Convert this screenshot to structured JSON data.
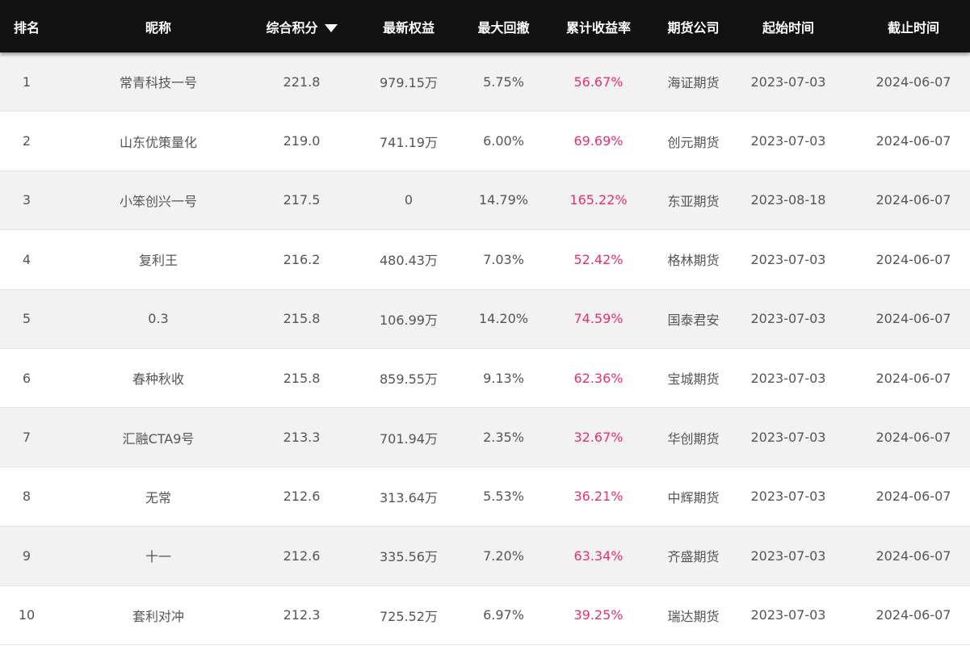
{
  "header": {
    "rank": "排名",
    "nickname": "昵称",
    "score": "综合积分",
    "equity": "最新权益",
    "drawdown": "最大回撤",
    "cumulative_return": "累计收益率",
    "broker": "期货公司",
    "start": "起始时间",
    "end": "截止时间"
  },
  "colors": {
    "header_bg": "#121212",
    "return_text": "#e8306b",
    "alt_row_bg": "#f2f2f2"
  },
  "rows": [
    {
      "rank": "1",
      "nickname": "常青科技一号",
      "score": "221.8",
      "equity": "979.15万",
      "drawdown": "5.75%",
      "cumulative_return": "56.67%",
      "broker": "海证期货",
      "start": "2023-07-03",
      "end": "2024-06-07"
    },
    {
      "rank": "2",
      "nickname": "山东优策量化",
      "score": "219.0",
      "equity": "741.19万",
      "drawdown": "6.00%",
      "cumulative_return": "69.69%",
      "broker": "创元期货",
      "start": "2023-07-03",
      "end": "2024-06-07"
    },
    {
      "rank": "3",
      "nickname": "小笨创兴一号",
      "score": "217.5",
      "equity": "0",
      "drawdown": "14.79%",
      "cumulative_return": "165.22%",
      "broker": "东亚期货",
      "start": "2023-08-18",
      "end": "2024-06-07"
    },
    {
      "rank": "4",
      "nickname": "复利王",
      "score": "216.2",
      "equity": "480.43万",
      "drawdown": "7.03%",
      "cumulative_return": "52.42%",
      "broker": "格林期货",
      "start": "2023-07-03",
      "end": "2024-06-07"
    },
    {
      "rank": "5",
      "nickname": "0.3",
      "score": "215.8",
      "equity": "106.99万",
      "drawdown": "14.20%",
      "cumulative_return": "74.59%",
      "broker": "国泰君安",
      "start": "2023-07-03",
      "end": "2024-06-07"
    },
    {
      "rank": "6",
      "nickname": "春种秋收",
      "score": "215.8",
      "equity": "859.55万",
      "drawdown": "9.13%",
      "cumulative_return": "62.36%",
      "broker": "宝城期货",
      "start": "2023-07-03",
      "end": "2024-06-07"
    },
    {
      "rank": "7",
      "nickname": "汇融CTA9号",
      "score": "213.3",
      "equity": "701.94万",
      "drawdown": "2.35%",
      "cumulative_return": "32.67%",
      "broker": "华创期货",
      "start": "2023-07-03",
      "end": "2024-06-07"
    },
    {
      "rank": "8",
      "nickname": "无常",
      "score": "212.6",
      "equity": "313.64万",
      "drawdown": "5.53%",
      "cumulative_return": "36.21%",
      "broker": "中辉期货",
      "start": "2023-07-03",
      "end": "2024-06-07"
    },
    {
      "rank": "9",
      "nickname": "十一",
      "score": "212.6",
      "equity": "335.56万",
      "drawdown": "7.20%",
      "cumulative_return": "63.34%",
      "broker": "齐盛期货",
      "start": "2023-07-03",
      "end": "2024-06-07"
    },
    {
      "rank": "10",
      "nickname": "套利对冲",
      "score": "212.3",
      "equity": "725.52万",
      "drawdown": "6.97%",
      "cumulative_return": "39.25%",
      "broker": "瑞达期货",
      "start": "2023-07-03",
      "end": "2024-06-07"
    }
  ]
}
